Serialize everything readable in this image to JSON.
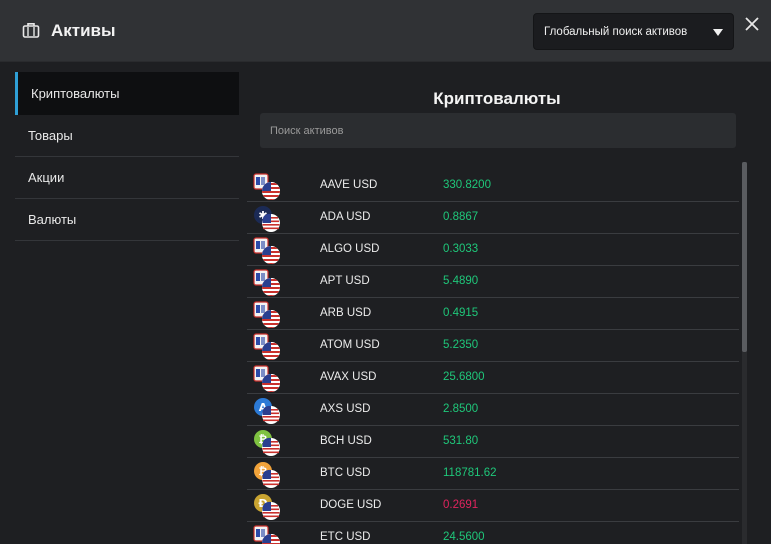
{
  "header": {
    "title": "Активы",
    "global_search_label": "Глобальный поиск активов"
  },
  "sidebar": {
    "items": [
      {
        "label": "Криптовалюты",
        "active": true
      },
      {
        "label": "Товары",
        "active": false
      },
      {
        "label": "Акции",
        "active": false
      },
      {
        "label": "Валюты",
        "active": false
      }
    ]
  },
  "main": {
    "title": "Криптовалюты",
    "search_placeholder": "Поиск активов"
  },
  "colors": {
    "up": "#1fc77a",
    "down": "#e0245e",
    "accent": "#2f9fd6"
  },
  "assets": [
    {
      "symbol": "AAVE USD",
      "price": "330.8200",
      "direction": "up",
      "icon": "flag-icon"
    },
    {
      "symbol": "ADA USD",
      "price": "0.8867",
      "direction": "up",
      "icon": "cardano-icon"
    },
    {
      "symbol": "ALGO USD",
      "price": "0.3033",
      "direction": "up",
      "icon": "flag-icon"
    },
    {
      "symbol": "APT USD",
      "price": "5.4890",
      "direction": "up",
      "icon": "flag-icon"
    },
    {
      "symbol": "ARB USD",
      "price": "0.4915",
      "direction": "up",
      "icon": "flag-icon"
    },
    {
      "symbol": "ATOM USD",
      "price": "5.2350",
      "direction": "up",
      "icon": "flag-icon"
    },
    {
      "symbol": "AVAX USD",
      "price": "25.6800",
      "direction": "up",
      "icon": "flag-icon"
    },
    {
      "symbol": "AXS USD",
      "price": "2.8500",
      "direction": "up",
      "icon": "axs-icon"
    },
    {
      "symbol": "BCH USD",
      "price": "531.80",
      "direction": "up",
      "icon": "bitcoin-cash-icon"
    },
    {
      "symbol": "BTC USD",
      "price": "118781.62",
      "direction": "up",
      "icon": "bitcoin-icon"
    },
    {
      "symbol": "DOGE USD",
      "price": "0.2691",
      "direction": "down",
      "icon": "dogecoin-icon"
    },
    {
      "symbol": "ETC USD",
      "price": "24.5600",
      "direction": "up",
      "icon": "flag-icon"
    }
  ]
}
